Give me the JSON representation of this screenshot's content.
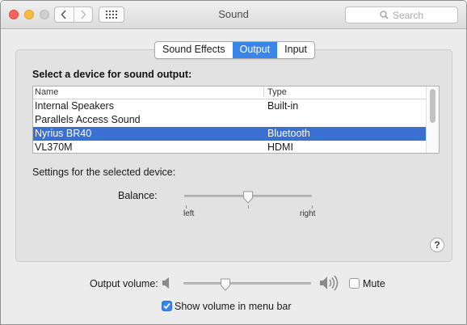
{
  "window": {
    "title": "Sound"
  },
  "toolbar": {
    "search_placeholder": "Search"
  },
  "tabs": [
    {
      "label": "Sound Effects",
      "active": false
    },
    {
      "label": "Output",
      "active": true
    },
    {
      "label": "Input",
      "active": false
    }
  ],
  "output": {
    "heading": "Select a device for sound output:",
    "columns": {
      "name": "Name",
      "type": "Type"
    },
    "devices": [
      {
        "name": "Internal Speakers",
        "type": "Built-in"
      },
      {
        "name": "Parallels Access Sound",
        "type": ""
      },
      {
        "name": "Nyrius BR40",
        "type": "Bluetooth",
        "selected": true
      },
      {
        "name": "VL370M",
        "type": "HDMI"
      }
    ],
    "settings_label": "Settings for the selected device:",
    "balance": {
      "label": "Balance:",
      "left": "left",
      "right": "right",
      "value_fraction": 0.5
    }
  },
  "volume": {
    "label": "Output volume:",
    "value_fraction": 0.33,
    "mute_label": "Mute",
    "muted": false,
    "show_in_menubar_label": "Show volume in menu bar",
    "show_in_menubar": true
  },
  "colors": {
    "accent": "#3b84e8",
    "selection": "#3b6fd3"
  },
  "icons": [
    "chevron-left-icon",
    "chevron-right-icon",
    "grid-icon",
    "search-icon",
    "speaker-low-icon",
    "speaker-high-icon",
    "help-icon",
    "checkmark-icon"
  ]
}
